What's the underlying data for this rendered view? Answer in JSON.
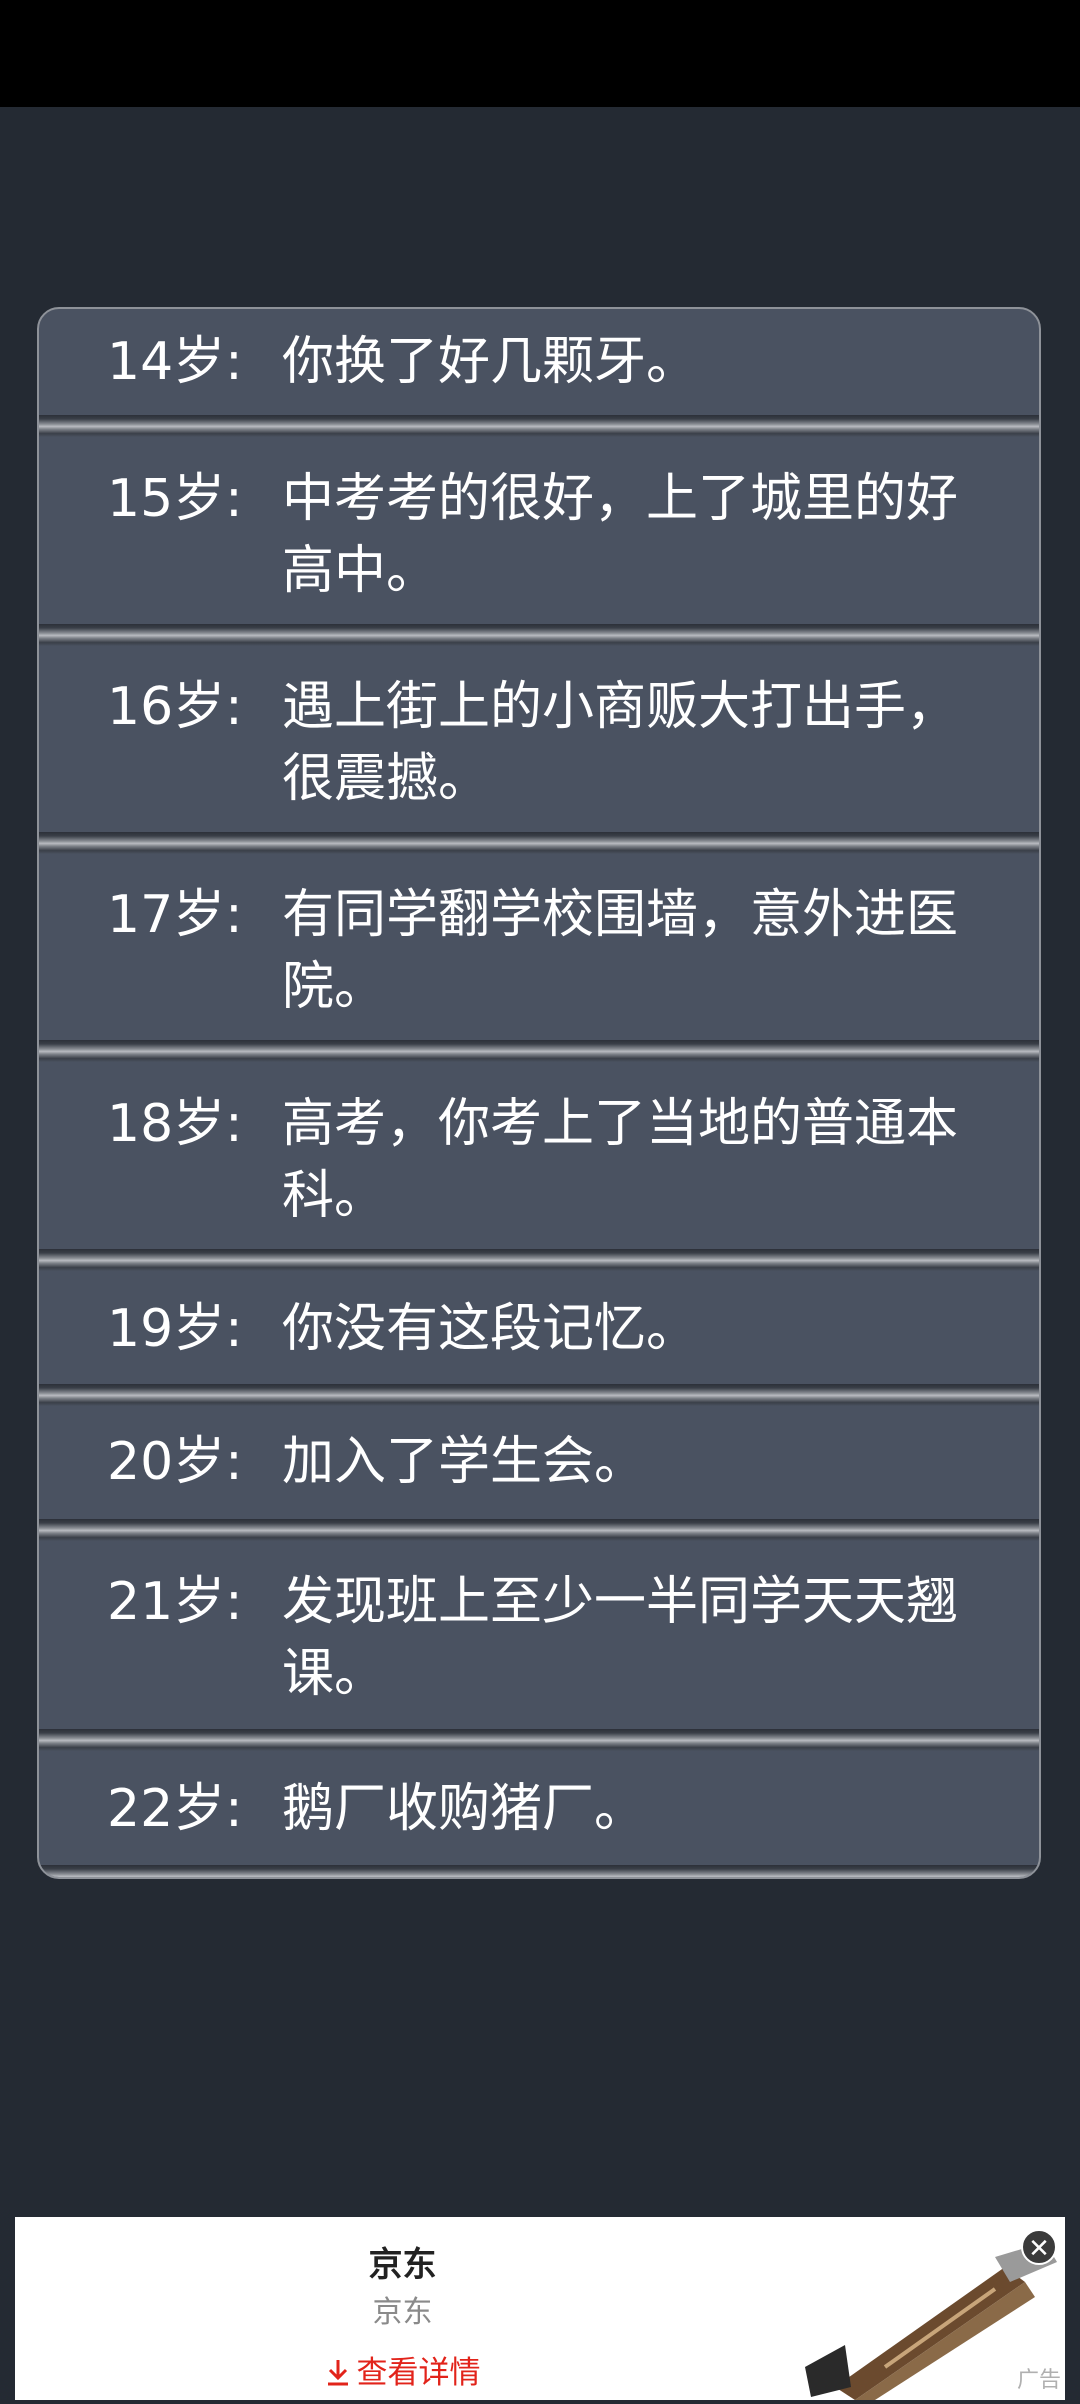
{
  "life_events": [
    {
      "age": "14岁:",
      "text": "你换了好几颗牙。"
    },
    {
      "age": "15岁:",
      "text": "中考考的很好，上了城里的好高中。"
    },
    {
      "age": "16岁:",
      "text": "遇上街上的小商贩大打出手，很震撼。"
    },
    {
      "age": "17岁:",
      "text": "有同学翻学校围墙，意外进医院。"
    },
    {
      "age": "18岁:",
      "text": "高考，你考上了当地的普通本科。"
    },
    {
      "age": "19岁:",
      "text": "你没有这段记忆。"
    },
    {
      "age": "20岁:",
      "text": "加入了学生会。"
    },
    {
      "age": "21岁:",
      "text": "发现班上至少一半同学天天翘课。"
    },
    {
      "age": "22岁:",
      "text": "鹅厂收购猪厂。"
    }
  ],
  "ad": {
    "title": "京东",
    "subtitle": "京东",
    "cta_label": "查看详情",
    "cta_icon": "download-arrow-icon",
    "close_icon": "close-icon",
    "ad_label": "广告",
    "cta_color": "#e2231a"
  },
  "colors": {
    "background": "#242a33",
    "panel": "#4a5261",
    "status_bar": "#000000"
  }
}
